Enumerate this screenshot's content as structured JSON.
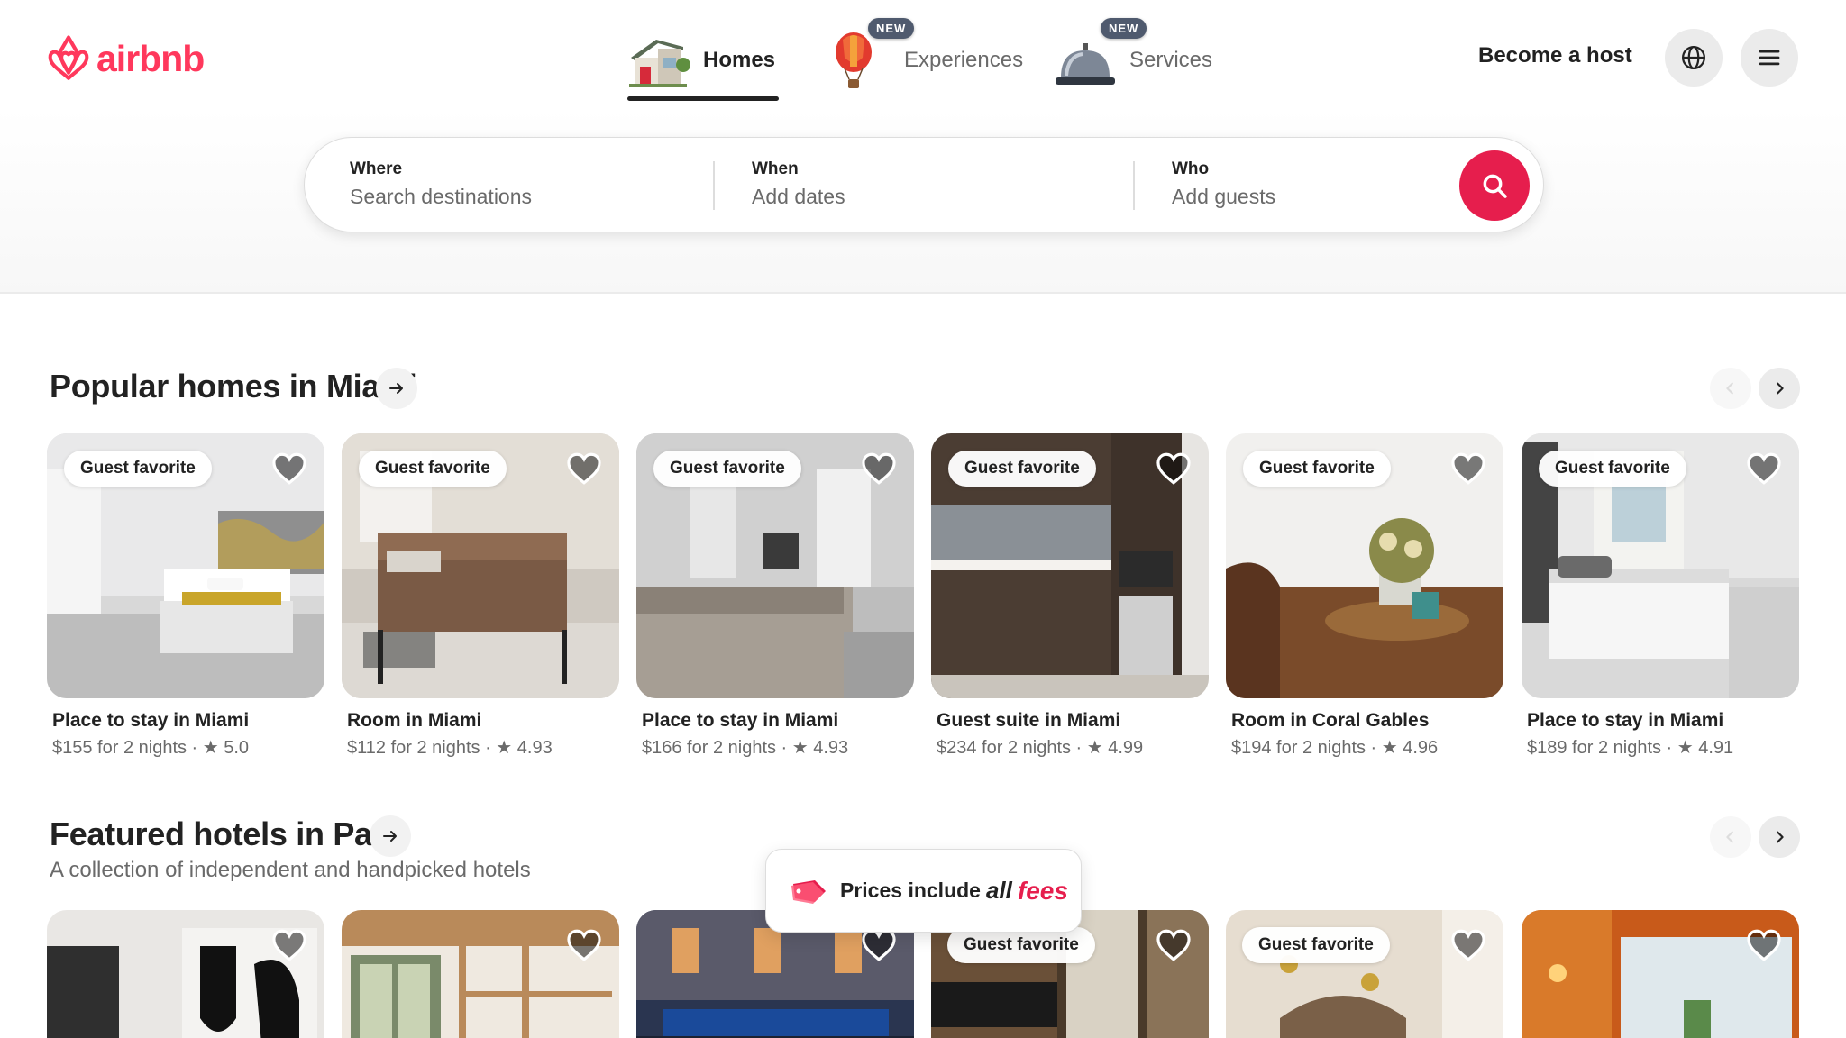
{
  "brand": {
    "name": "airbnb",
    "color": "#ff385c"
  },
  "nav": {
    "tabs": [
      {
        "label": "Homes",
        "icon": "house-icon",
        "active": true,
        "badge": ""
      },
      {
        "label": "Experiences",
        "icon": "hot-air-balloon-icon",
        "active": false,
        "badge": "NEW"
      },
      {
        "label": "Services",
        "icon": "service-bell-icon",
        "active": false,
        "badge": "NEW"
      }
    ],
    "become_host": "Become a host",
    "globe_icon": "globe-icon",
    "menu_icon": "hamburger-menu-icon"
  },
  "search": {
    "where": {
      "label": "Where",
      "placeholder": "Search destinations"
    },
    "when": {
      "label": "When",
      "placeholder": "Add dates"
    },
    "who": {
      "label": "Who",
      "placeholder": "Add guests"
    },
    "button_icon": "search-icon",
    "button_color": "#e61e4d"
  },
  "popular": {
    "title": "Popular homes in Miami",
    "listings": [
      {
        "badge": "Guest favorite",
        "title": "Place to stay in Miami",
        "meta": "$155 for 2 nights · ★ 5.0"
      },
      {
        "badge": "Guest favorite",
        "title": "Room in Miami",
        "meta": "$112 for 2 nights · ★ 4.93"
      },
      {
        "badge": "Guest favorite",
        "title": "Place to stay in Miami",
        "meta": "$166 for 2 nights · ★ 4.93"
      },
      {
        "badge": "Guest favorite",
        "title": "Guest suite in Miami",
        "meta": "$234 for 2 nights · ★ 4.99"
      },
      {
        "badge": "Guest favorite",
        "title": "Room in Coral Gables",
        "meta": "$194 for 2 nights · ★ 4.96"
      },
      {
        "badge": "Guest favorite",
        "title": "Place to stay in Miami",
        "meta": "$189 for 2 nights · ★ 4.91"
      }
    ]
  },
  "featured": {
    "title": "Featured hotels in Paris",
    "subtitle": "A collection of independent and handpicked hotels",
    "listings": [
      {
        "badge": ""
      },
      {
        "badge": ""
      },
      {
        "badge": ""
      },
      {
        "badge": "Guest favorite"
      },
      {
        "badge": "Guest favorite"
      },
      {
        "badge": ""
      }
    ]
  },
  "toast": {
    "prefix": "Prices include",
    "all": "all",
    "fees": "fees",
    "icon": "price-tag-icon"
  }
}
